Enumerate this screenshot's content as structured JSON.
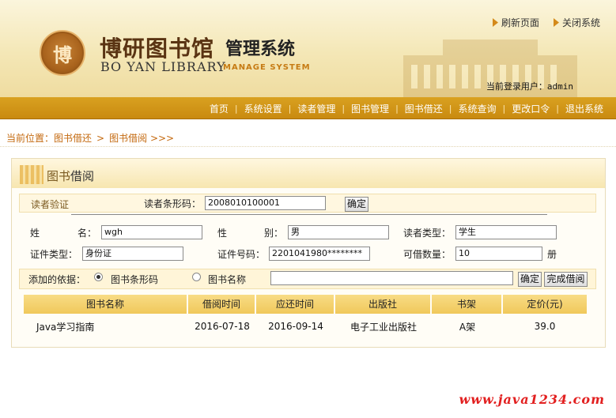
{
  "header": {
    "logo_seal": "博",
    "brand_cn": "博研图书馆",
    "brand_sub": "管理系统",
    "brand_en": "BO YAN LIBRARY",
    "brand_ms": "MANAGE SYSTEM",
    "refresh_label": "刷新页面",
    "close_label": "关闭系统",
    "login_label": "当前登录用户：",
    "login_user": "admin"
  },
  "nav": {
    "items": [
      "首页",
      "系统设置",
      "读者管理",
      "图书管理",
      "图书借还",
      "系统查询",
      "更改口令",
      "退出系统"
    ],
    "separator": "|"
  },
  "breadcrumb": {
    "prefix": "当前位置：",
    "level1": "图书借还",
    "level2": "图书借阅",
    "arrow": ">",
    "suffix": ">>>"
  },
  "panel": {
    "title_a": "图书",
    "title_b": "借阅"
  },
  "reader": {
    "verify_label": "读者验证",
    "barcode_label": "读者条形码：",
    "barcode_value": "2008010100001",
    "confirm_label": "确定",
    "name_label_a": "姓",
    "name_label_b": "名：",
    "name_value": "wgh",
    "gender_label_a": "性",
    "gender_label_b": "别：",
    "gender_value": "男",
    "type_label": "读者类型：",
    "type_value": "学生",
    "id_type_label": "证件类型：",
    "id_type_value": "身份证",
    "id_no_label": "证件号码：",
    "id_no_value": "2201041980********",
    "borrow_count_label": "可借数量：",
    "borrow_count_value": "10",
    "borrow_unit": "册"
  },
  "add": {
    "label": "添加的依据：",
    "opt_barcode": "图书条形码",
    "opt_name": "图书名称",
    "search_value": "",
    "confirm_label": "确定",
    "finish_label": "完成借阅"
  },
  "table": {
    "headers": [
      "图书名称",
      "借阅时间",
      "应还时间",
      "出版社",
      "书架",
      "定价(元)"
    ],
    "rows": [
      [
        "Java学习指南",
        "2016-07-18",
        "2016-09-14",
        "电子工业出版社",
        "A架",
        "39.0"
      ]
    ]
  },
  "footer": {
    "watermark": "www.java1234.com"
  },
  "colors": {
    "nav_bg": "#d39a18",
    "accent": "#c46a10",
    "table_header": "#f4d06a",
    "watermark": "#e22020"
  }
}
